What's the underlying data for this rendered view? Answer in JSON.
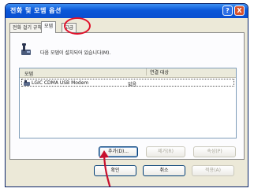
{
  "window": {
    "title": "전화 및 모뎀 옵션",
    "help_label": "?",
    "close_label": "X"
  },
  "tabs": [
    {
      "label": "전화 걸기 규칙"
    },
    {
      "label": "모뎀"
    },
    {
      "label": "고급"
    }
  ],
  "active_tab": "모뎀",
  "panel": {
    "description": "다음 모뎀이 설치되어 있습니다(M).",
    "icon": "phone-modem-icon"
  },
  "list": {
    "columns": [
      "모뎀",
      "연결 대상"
    ],
    "rows": [
      {
        "model": "LGIC CDMA USB Modem",
        "port": "없음",
        "icon": "modem-icon"
      }
    ]
  },
  "buttons": {
    "add": "추가(D)...",
    "remove": "제거(R)",
    "properties": "속성(P)",
    "ok": "확인",
    "cancel": "취소",
    "apply": "적용(A)"
  },
  "annotations": {
    "circle_color": "#e0102a",
    "arrow_color": "#c8102e"
  }
}
